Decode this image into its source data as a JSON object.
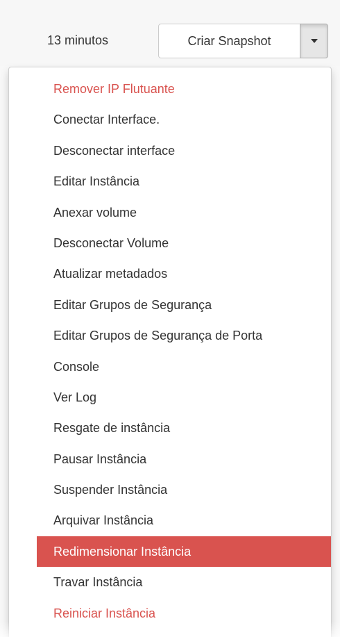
{
  "toolbar": {
    "time_text": "13 minutos",
    "snapshot_label": "Criar Snapshot",
    "toggle_icon": "caret-down-icon"
  },
  "menu": {
    "items": [
      {
        "label": "Remover IP Flutuante",
        "style": "danger"
      },
      {
        "label": "Conectar Interface.",
        "style": "normal"
      },
      {
        "label": "Desconectar interface",
        "style": "normal"
      },
      {
        "label": "Editar Instância",
        "style": "normal"
      },
      {
        "label": "Anexar volume",
        "style": "normal"
      },
      {
        "label": "Desconectar Volume",
        "style": "normal"
      },
      {
        "label": "Atualizar metadados",
        "style": "normal"
      },
      {
        "label": "Editar Grupos de Segurança",
        "style": "normal"
      },
      {
        "label": "Editar Grupos de Segurança de Porta",
        "style": "normal"
      },
      {
        "label": "Console",
        "style": "normal"
      },
      {
        "label": "Ver Log",
        "style": "normal"
      },
      {
        "label": "Resgate de instância",
        "style": "normal"
      },
      {
        "label": "Pausar Instância",
        "style": "normal"
      },
      {
        "label": "Suspender Instância",
        "style": "normal"
      },
      {
        "label": "Arquivar Instância",
        "style": "normal"
      },
      {
        "label": "Redimensionar Instância",
        "style": "active"
      },
      {
        "label": "Travar Instância",
        "style": "normal"
      },
      {
        "label": "Reiniciar Instância",
        "style": "danger"
      }
    ]
  },
  "colors": {
    "danger": "#d9534f",
    "text": "#333333",
    "active_bg": "#d9534f"
  }
}
